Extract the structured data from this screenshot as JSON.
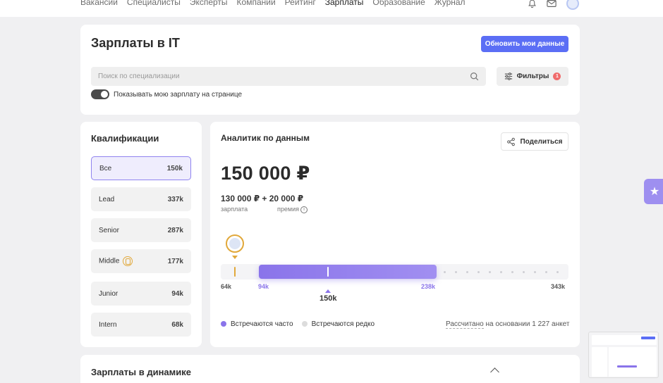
{
  "nav": {
    "items": [
      "Вакансии",
      "Специалисты",
      "Эксперты",
      "Компании",
      "Рейтинг",
      "Зарплаты",
      "Образование",
      "Журнал"
    ],
    "active": "Зарплаты",
    "icons": [
      "bell-icon",
      "mail-icon",
      "avatar"
    ]
  },
  "header": {
    "title": "Зарплаты в IT",
    "update_button": "Обновить мои данные",
    "search_placeholder": "Поиск по специализации",
    "filters_label": "Фильтры",
    "filters_count": "1",
    "toggle_label": "Показывать мою зарплату на странице",
    "toggle_on": true
  },
  "qualifications": {
    "title": "Квалификации",
    "items": [
      {
        "label": "Все",
        "value": "150k",
        "active": true
      },
      {
        "label": "Lead",
        "value": "337k"
      },
      {
        "label": "Senior",
        "value": "287k"
      },
      {
        "label": "Middle",
        "value": "177k",
        "medal": true
      },
      {
        "label": "Junior",
        "value": "94k"
      },
      {
        "label": "Intern",
        "value": "68k"
      }
    ]
  },
  "analytics": {
    "title": "Аналитик по данным",
    "share_label": "Поделиться",
    "total": "150 000 ₽",
    "split": "130 000 ₽ + 20 000 ₽",
    "salary_label": "зарплата",
    "bonus_label": "премия",
    "scale": {
      "min": 64,
      "max": 343,
      "range_low": 94,
      "range_high": 238,
      "current": 150,
      "mine": 75,
      "labels": {
        "min": "64k",
        "low": "94k",
        "high": "238k",
        "max": "343k",
        "current": "150k"
      }
    },
    "legend": {
      "often": "Встречаются часто",
      "rare": "Встречаются редко"
    },
    "calc_link": "Рассчитано",
    "calc_rest": " на основании 1 227 анкет",
    "colors": {
      "accent": "#8a74ea",
      "gold": "#e1a83a",
      "button": "#5b6ef5"
    }
  },
  "dynamics": {
    "title": "Зарплаты в динамике"
  }
}
